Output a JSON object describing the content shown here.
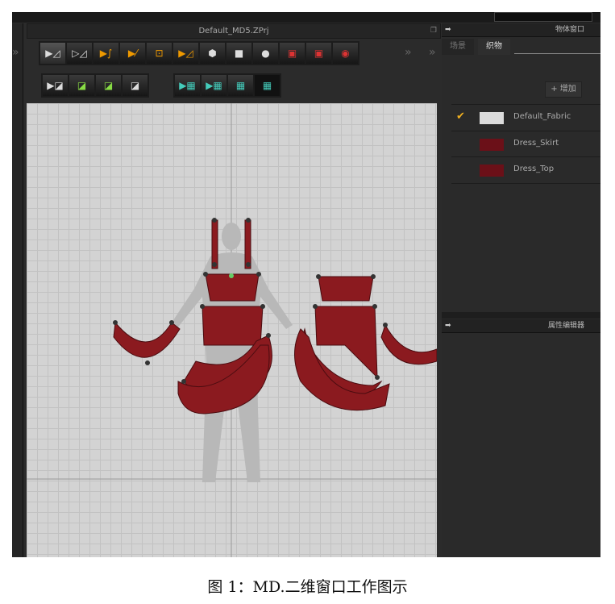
{
  "window": {
    "title": "Default_MD5.ZPrj"
  },
  "toolbar": {
    "row1_icons": [
      "select-mesh-icon",
      "transform-pattern-icon",
      "curve-point-icon",
      "edit-curvature-icon",
      "add-point-icon",
      "edit-pattern-icon",
      "polygon-icon",
      "rectangle-icon",
      "circle-icon",
      "internal-polygon-icon",
      "internal-rectangle-icon",
      "internal-circle-icon"
    ],
    "row2_icons": [
      "segment-sewing-icon",
      "free-sewing-icon",
      "elastic-sewing-icon",
      "sewing-visibility-icon"
    ],
    "row3_icons": [
      "edit-texture-icon",
      "transform-texture-icon",
      "texture-icon",
      "texture-visibility-icon"
    ]
  },
  "object_panel": {
    "title": "物体窗口",
    "tabs": [
      {
        "label": "场景"
      },
      {
        "label": "织物"
      }
    ],
    "add_label": "+ 增加",
    "fabrics": [
      {
        "name": "Default_Fabric",
        "color": "#dcdcdc",
        "selected": true
      },
      {
        "name": "Dress_Skirt",
        "color": "#6b1018",
        "selected": false
      },
      {
        "name": "Dress_Top",
        "color": "#6b1018",
        "selected": false
      }
    ]
  },
  "property_panel": {
    "title": "属性编辑器"
  },
  "caption": "图 1：MD.二维窗口工作图示"
}
